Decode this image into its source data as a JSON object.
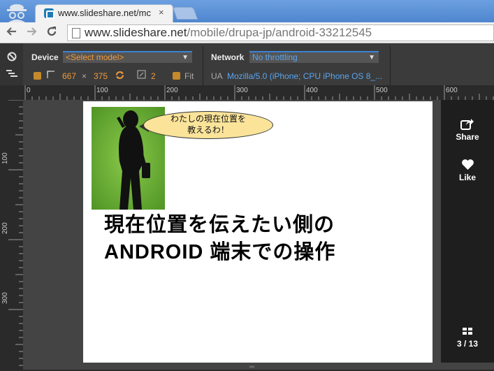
{
  "browser": {
    "tab_title": "www.slideshare.net/mc",
    "tab_close": "×",
    "url_host": "www.slideshare.net",
    "url_path": "/mobile/drupa-jp/android-33212545"
  },
  "devtools": {
    "device_label": "Device",
    "device_select": "<Select model>",
    "width": "667",
    "times": "×",
    "height": "375",
    "pixel_ratio": "2",
    "fit_label": "Fit",
    "network_label": "Network",
    "network_select": "No throttling",
    "ua_label": "UA",
    "ua_value": "Mozilla/5.0 (iPhone; CPU iPhone OS 8_..."
  },
  "rulers": {
    "top_ticks": [
      "0",
      "100",
      "200",
      "300",
      "400",
      "500",
      "600"
    ],
    "left_ticks": [
      "100",
      "200",
      "300"
    ]
  },
  "slide": {
    "bubble_text": "わたしの現在位置を\n教えるわ！",
    "title": "現在位置を伝えたい側の\nANDROID 端末での操作"
  },
  "sidebar": {
    "share_label": "Share",
    "like_label": "Like",
    "page_counter": "3 / 13"
  },
  "colors": {
    "accent_red": "#d9222c",
    "devtools_orange": "#f29a3a",
    "devtools_blue": "#5aa5f0",
    "photo_green": "#6fb33a",
    "bubble_yellow": "#fbe49a"
  }
}
